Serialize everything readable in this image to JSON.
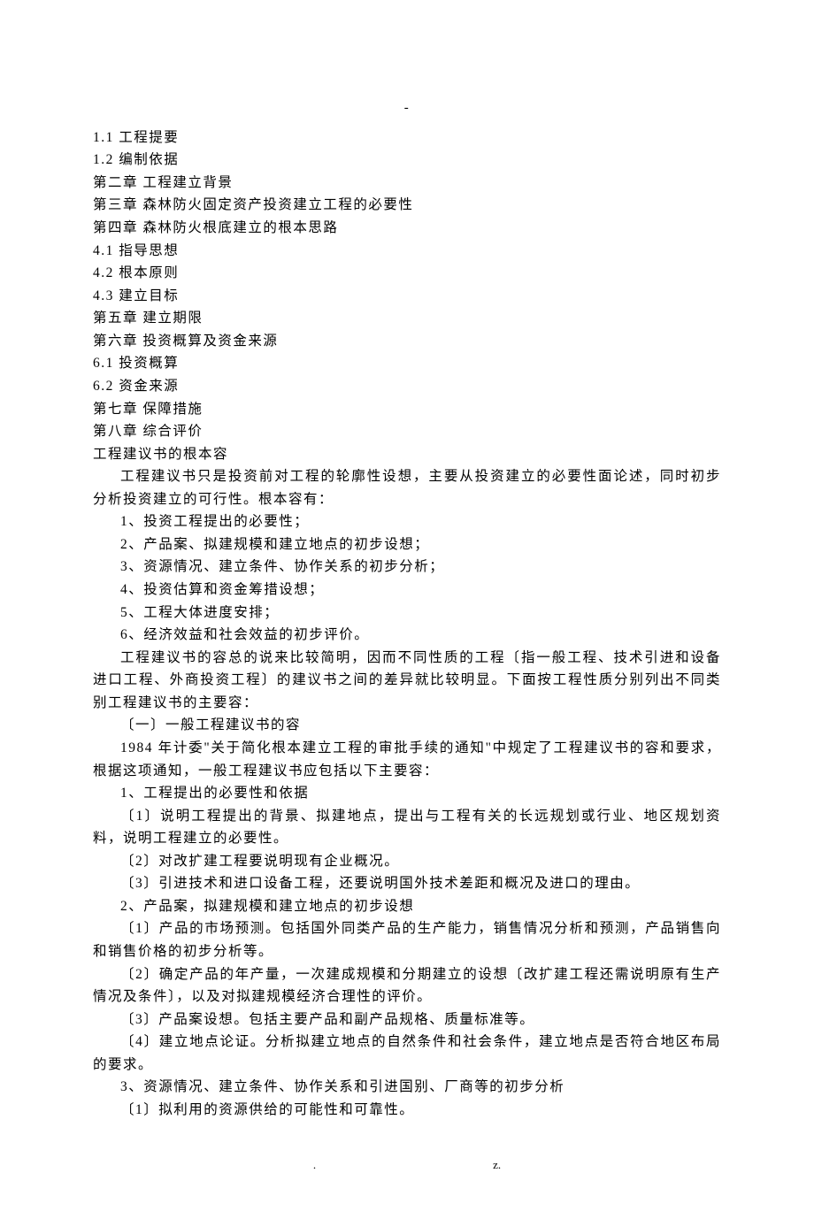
{
  "topDash": "-",
  "toc": [
    "1.1 工程提要",
    "1.2 编制依据",
    "第二章 工程建立背景",
    "第三章 森林防火固定资产投资建立工程的必要性",
    "第四章 森林防火根底建立的根本思路",
    "4.1 指导思想",
    "4.2 根本原则",
    "4.3 建立目标",
    "第五章 建立期限",
    "第六章 投资概算及资金来源",
    "6.1 投资概算",
    "6.2 资金来源",
    "第七章 保障措施",
    "第八章 综合评价"
  ],
  "heading": "工程建议书的根本容",
  "intro": "工程建议书只是投资前对工程的轮廓性设想，主要从投资建立的必要性面论述，同时初步分析投资建立的可行性。根本容有：",
  "basicList": [
    "1、投资工程提出的必要性；",
    "2、产品案、拟建规模和建立地点的初步设想；",
    "3、资源情况、建立条件、协作关系的初步分析；",
    "4、投资估算和资金筹措设想；",
    "5、工程大体进度安排；",
    "6、经济效益和社会效益的初步评价。"
  ],
  "paraA": "工程建议书的容总的说来比较简明，因而不同性质的工程〔指一般工程、技术引进和设备进口工程、外商投资工程〕的建议书之间的差异就比较明显。下面按工程性质分别列出不同类别工程建议书的主要容：",
  "sectionTitle": "〔一〕一般工程建议书的容",
  "paraB": "1984 年计委\"关于简化根本建立工程的审批手续的通知\"中规定了工程建议书的容和要求，根据这项通知，一般工程建议书应包括以下主要容：",
  "item1Title": "1、工程提出的必要性和依据",
  "item1a": "〔1〕说明工程提出的背景、拟建地点，提出与工程有关的长远规划或行业、地区规划资料，说明工程建立的必要性。",
  "item1b": "〔2〕对改扩建工程要说明现有企业概况。",
  "item1c": "〔3〕引进技术和进口设备工程，还要说明国外技术差距和概况及进口的理由。",
  "item2Title": "2、产品案，拟建规模和建立地点的初步设想",
  "item2a": "〔1〕产品的市场预测。包括国外同类产品的生产能力，销售情况分析和预测，产品销售向和销售价格的初步分析等。",
  "item2b": "〔2〕确定产品的年产量，一次建成规模和分期建立的设想〔改扩建工程还需说明原有生产情况及条件〕，以及对拟建规模经济合理性的评价。",
  "item2c": "〔3〕产品案设想。包括主要产品和副产品规格、质量标准等。",
  "item2d": "〔4〕建立地点论证。分析拟建立地点的自然条件和社会条件，建立地点是否符合地区布局的要求。",
  "item3Title": "3、资源情况、建立条件、协作关系和引进国别、厂商等的初步分析",
  "item3a": "〔1〕拟利用的资源供给的可能性和可靠性。",
  "footerDot": ".",
  "footerZ": "z."
}
